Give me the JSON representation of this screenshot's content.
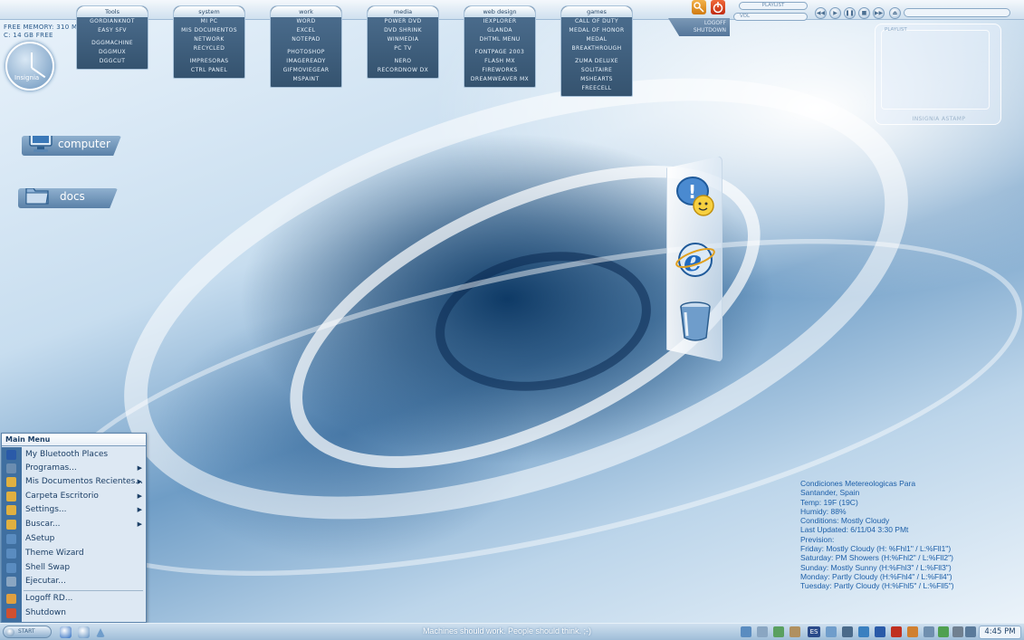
{
  "system_info": {
    "memory": "FREE MEMORY: 310 MB",
    "disk": "C: 14 GB FREE"
  },
  "clock_widget": {
    "label": "Insignia"
  },
  "top_menus": [
    {
      "title": "Tools",
      "groups": [
        [
          "GORDIANKNOT",
          "EASY SFV"
        ],
        [
          "DGGMACHINE",
          "DGGMUX",
          "DGGCUT"
        ]
      ]
    },
    {
      "title": "system",
      "groups": [
        [
          "MI PC",
          "MIS DOCUMENTOS",
          "NETWORK",
          "RECYCLED"
        ],
        [
          "IMPRESORAS",
          "CTRL PANEL"
        ]
      ]
    },
    {
      "title": "work",
      "groups": [
        [
          "WORD",
          "EXCEL",
          "NOTEPAD"
        ],
        [
          "PHOTOSHOP",
          "IMAGEREADY",
          "GIFMOVIEGEAR",
          "MSPAINT"
        ]
      ]
    },
    {
      "title": "media",
      "groups": [
        [
          "POWER DVD",
          "DVD SHRINK",
          "WINMEDIA",
          "PC TV"
        ],
        [
          "NERO",
          "RECORDNOW DX"
        ]
      ]
    },
    {
      "title": "web design",
      "groups": [
        [
          "IEXPLORER",
          "GLANDA",
          "DHTML MENU"
        ],
        [
          "FONTPAGE 2003",
          "FLASH MX",
          "FIREWORKS",
          "DREAMWEAVER MX"
        ]
      ]
    },
    {
      "title": "games",
      "groups": [
        [
          "CALL OF DUTY",
          "MEDAL OF HONOR",
          "MEDAL BREAKTHROUGH"
        ],
        [
          "ZUMA DELUXE",
          "SOLITAIRE",
          "MSHEARTS",
          "FREECELL"
        ]
      ]
    }
  ],
  "logoff_panel": {
    "line1": "LOGOFF",
    "line2": "SHUTDOWN"
  },
  "player": {
    "playlist_label": "PLAYLIST",
    "vol_label": "VOL",
    "buttons": [
      "◀◀",
      "▶",
      "❚❚",
      "■",
      "▶▶",
      "⏏"
    ]
  },
  "playlist_panel": {
    "title": "PLAYLIST",
    "credit": "INSIGNIA ASTAMP"
  },
  "desktop_icons": [
    {
      "label": "computer",
      "icon": "monitor-icon"
    },
    {
      "label": "docs",
      "icon": "folder-icon"
    }
  ],
  "dock_icons": [
    "messenger-icon",
    "internet-explorer-icon",
    "bucket-icon"
  ],
  "start_menu": {
    "header": "Main Menu",
    "items": [
      {
        "label": "My Bluetooth Places",
        "icon": "bluetooth-icon",
        "color": "#2a5aa8",
        "submenu": false
      },
      {
        "label": "Programas...",
        "icon": "programs-icon",
        "color": "#6b8db0",
        "submenu": true
      },
      {
        "label": "Mis Documentos Recientes...",
        "icon": "recent-docs-icon",
        "color": "#e0b040",
        "submenu": true
      },
      {
        "label": "Carpeta Escritorio",
        "icon": "folder-icon",
        "color": "#e0b040",
        "submenu": true
      },
      {
        "label": "Settings...",
        "icon": "settings-icon",
        "color": "#e0b040",
        "submenu": true
      },
      {
        "label": "Buscar...",
        "icon": "search-icon",
        "color": "#e0b040",
        "submenu": true
      },
      {
        "label": "ASetup",
        "icon": "asetup-icon",
        "color": "#5a8cc0",
        "submenu": false
      },
      {
        "label": "Theme Wizard",
        "icon": "theme-wizard-icon",
        "color": "#5a8cc0",
        "submenu": false
      },
      {
        "label": "Shell Swap",
        "icon": "shell-swap-icon",
        "color": "#5a8cc0",
        "submenu": false
      },
      {
        "label": "Ejecutar...",
        "icon": "run-icon",
        "color": "#8aa6c2",
        "submenu": false
      },
      {
        "label": "Logoff RD...",
        "icon": "logoff-icon",
        "color": "#e0a040",
        "submenu": false
      },
      {
        "label": "Shutdown",
        "icon": "shutdown-icon",
        "color": "#d05030",
        "submenu": false
      }
    ]
  },
  "weather": {
    "lines": [
      "Condiciones Metereologicas Para",
      "Santander, Spain",
      "Temp: 19F (19C)",
      "Humidy: 88%",
      "Conditions: Mostly Cloudy",
      "Last Updated: 6/11/04 3:30 PMt",
      "Prevision:",
      "Friday: Mostly Cloudy (H: %Fhl1\" / L:%Fll1\")",
      "Saturday: PM Showers (H:%Fhl2\" / L:%Fll2\")",
      "Sunday: Mostly Sunny (H:%Fhl3\" / L:%Fll3\")",
      "Monday: Partly Cloudy (H:%Fhl4\" / L:%Fll4\")",
      "Tuesday: Partly Cloudy (H:%Fhl5\" / L:%Fll5\")"
    ]
  },
  "taskbar": {
    "start_label": "START",
    "motto": "Machines should work. People should think. ;-)",
    "tray_icons": [
      "network-icon",
      "printer-icon",
      "sync-icon",
      "timer-icon",
      "language-es-icon",
      "monitor-icon",
      "volume-icon",
      "messenger-icon",
      "bluetooth-icon",
      "antivirus-icon",
      "firewall-icon",
      "tool-icon",
      "usb-icon",
      "pen-icon",
      "tablet-icon",
      "search-icon",
      "display-icon"
    ],
    "lang": "ES",
    "clock": "4:45 PM"
  },
  "colors": {
    "accent": "#3f6fa0",
    "weather_text": "#1d5fa8",
    "menu_bg": "#3f5f80"
  }
}
